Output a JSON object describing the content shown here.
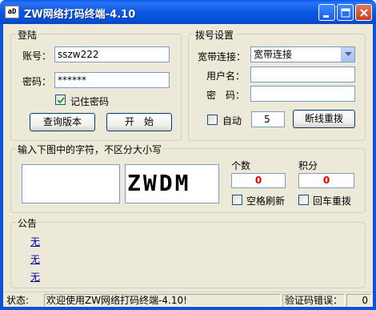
{
  "window": {
    "title": "ZW网络打码终端-4.10",
    "app_icon_text": "aD"
  },
  "login": {
    "group_title": "登陆",
    "account_label": "账号：",
    "account_value": "sszw222",
    "password_label": "密码：",
    "password_value": "******",
    "remember_label": "记住密码",
    "remember_checked": true,
    "query_button": "查询版本",
    "start_button": "开　始"
  },
  "dial": {
    "group_title": "拨号设置",
    "conn_label": "宽带连接：",
    "conn_value": "宽带连接",
    "user_label": "用户名：",
    "user_value": "",
    "pass_label": "密　码：",
    "pass_value": "",
    "auto_label": "自动",
    "auto_checked": false,
    "auto_value": "5",
    "redial_button": "断线重拨"
  },
  "captcha": {
    "group_title": "输入下图中的字符，不区分大小写",
    "image_text": "ZWDM",
    "count_label": "个数",
    "count_value": "0",
    "score_label": "积分",
    "score_value": "0",
    "space_refresh_label": "空格刷新",
    "enter_redial_label": "回车重拨"
  },
  "notice": {
    "group_title": "公告",
    "items": [
      "无",
      "无",
      "无"
    ]
  },
  "status": {
    "label": "状态:",
    "message": "欢迎使用ZW网络打码终端-4.10!",
    "error_label": "验证码错误：",
    "error_value": "0"
  },
  "colors": {
    "title_bar": "#0a5bf0",
    "client_bg": "#ece9d8",
    "count_text": "#e00000",
    "notice_link": "#0000a0"
  }
}
